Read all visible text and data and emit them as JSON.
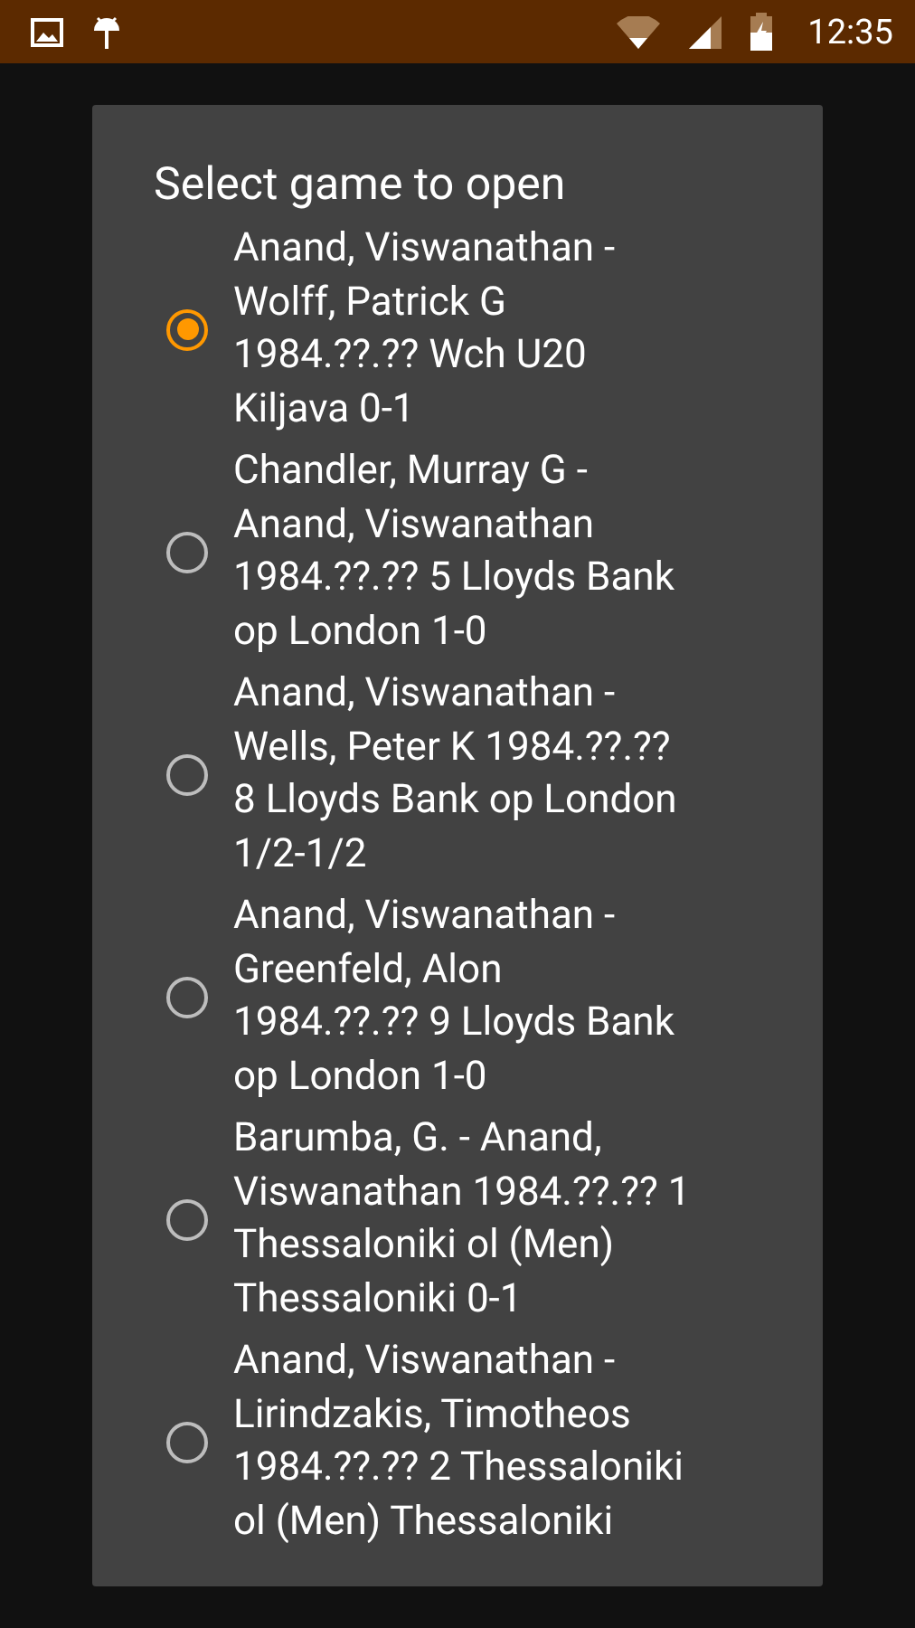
{
  "status_bar": {
    "time": "12:35"
  },
  "dialog": {
    "title": "Select game to open",
    "games": [
      {
        "lines": [
          "Anand, Viswanathan -",
          "Wolff, Patrick G",
          "1984.??.?? Wch U20",
          "Kiljava 0-1"
        ],
        "selected": true
      },
      {
        "lines": [
          "Chandler, Murray G -",
          "Anand, Viswanathan",
          "1984.??.?? 5 Lloyds Bank",
          "op London 1-0"
        ],
        "selected": false
      },
      {
        "lines": [
          "Anand, Viswanathan -",
          "Wells, Peter K 1984.??.??",
          "8 Lloyds Bank op London",
          "1/2-1/2"
        ],
        "selected": false
      },
      {
        "lines": [
          "Anand, Viswanathan -",
          "Greenfeld, Alon",
          "1984.??.?? 9 Lloyds Bank",
          "op London 1-0"
        ],
        "selected": false
      },
      {
        "lines": [
          "Barumba, G. - Anand,",
          "Viswanathan 1984.??.?? 1",
          "Thessaloniki ol (Men)",
          "Thessaloniki 0-1"
        ],
        "selected": false
      },
      {
        "lines": [
          "Anand, Viswanathan -",
          "Lirindzakis, Timotheos",
          "1984.??.?? 2 Thessaloniki",
          "ol (Men) Thessaloniki"
        ],
        "selected": false
      }
    ]
  }
}
